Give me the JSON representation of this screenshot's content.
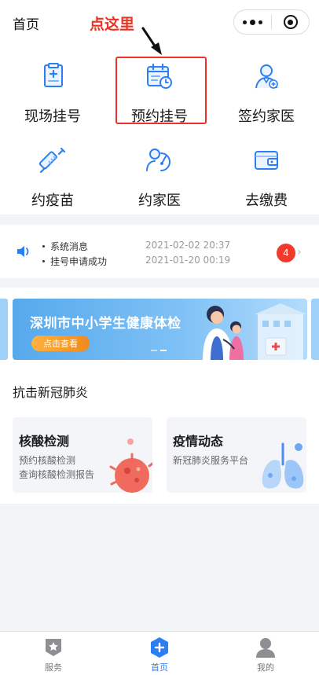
{
  "header": {
    "title": "首页",
    "annotation": "点这里"
  },
  "services": [
    {
      "label": "现场挂号",
      "icon": "clipboard-cross-icon"
    },
    {
      "label": "预约挂号",
      "icon": "calendar-clock-icon"
    },
    {
      "label": "签约家医",
      "icon": "doctor-icon"
    },
    {
      "label": "约疫苗",
      "icon": "syringe-icon"
    },
    {
      "label": "约家医",
      "icon": "family-doctor-icon"
    },
    {
      "label": "去缴费",
      "icon": "wallet-icon"
    }
  ],
  "notices": {
    "items": [
      {
        "text": "系统消息",
        "date": "2021-02-02 20:37"
      },
      {
        "text": "挂号申请成功",
        "date": "2021-01-20 00:19"
      }
    ],
    "unread_count": "4"
  },
  "banner": {
    "title": "深圳市中小学生健康体检",
    "button": "点击查看"
  },
  "section": {
    "title": "抗击新冠肺炎",
    "cards": [
      {
        "title": "核酸检测",
        "lines": [
          "预约核酸检测",
          "查询核酸检测报告"
        ]
      },
      {
        "title": "疫情动态",
        "lines": [
          "新冠肺炎服务平台"
        ]
      }
    ]
  },
  "tabbar": [
    {
      "label": "服务",
      "icon": "star-badge-icon",
      "active": false
    },
    {
      "label": "首页",
      "icon": "plus-hexagon-icon",
      "active": true
    },
    {
      "label": "我的",
      "icon": "user-icon",
      "active": false
    }
  ],
  "colors": {
    "accent": "#2b7ff3",
    "annotation": "#ea3323",
    "badge": "#ef3a2c"
  }
}
